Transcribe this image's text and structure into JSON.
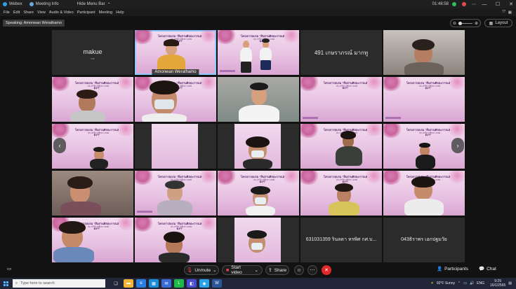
{
  "titlebar": {
    "app_name": "Webex",
    "meeting_info": "Meeting Info",
    "hide_menu": "Hide Menu Bar",
    "time": "01:48:58"
  },
  "menu": {
    "items": [
      "File",
      "Edit",
      "Share",
      "View",
      "Audio & Video",
      "Participant",
      "Meeting",
      "Help"
    ]
  },
  "speaking": "Speaking: Amonwan Werathamo",
  "layout_label": "Layout",
  "tiles": {
    "makue_name": "makue",
    "makue_sub": "me",
    "active_speaker": "Amonwan Werathamo",
    "t491_name": "491 เกษราภรณ์ มากทู",
    "t631_name": "631031359 รินลดา หรพิศ กศ.บ...",
    "t043_name": "043ธิราพร เอกปฐมวัย",
    "banner_main": "โครงการอบรม \"สืบสานศิลปะการแสดงฯ\"",
    "banner_sub": "ประจำปีการศึกษา 2565"
  },
  "controls": {
    "unmute": "Unmute",
    "start_video": "Start video",
    "share": "Share",
    "participants": "Participants",
    "chat": "Chat"
  },
  "taskbar": {
    "search_placeholder": "Type here to search",
    "weather": "92°F  Sunny",
    "lang": "ENG",
    "time": "9:29",
    "date": "16/1/2565"
  },
  "colors": {
    "end_call": "#e02828",
    "active_outline": "#8ec8ff",
    "pink_bg": "#e8c3e3"
  }
}
